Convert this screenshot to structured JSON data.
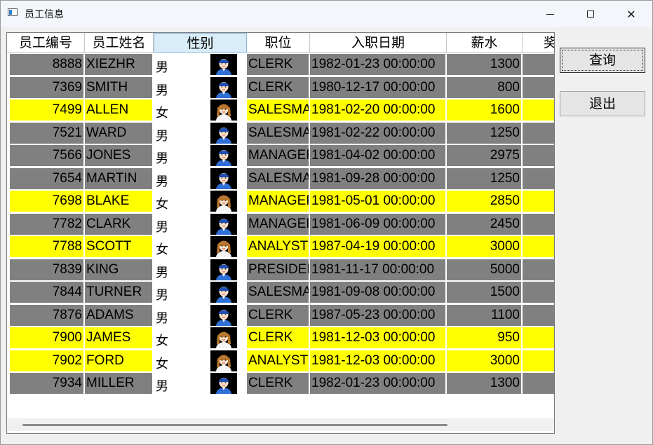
{
  "window": {
    "title": "员工信息"
  },
  "columns": [
    "员工编号",
    "员工姓名",
    "性别",
    "职位",
    "入职日期",
    "薪水",
    "奖"
  ],
  "colors": {
    "male_row": "#808080",
    "female_row": "#ffff00",
    "header_selected": "#d9edf9"
  },
  "rows": [
    {
      "empno": "8888",
      "ename": "XIEZHR",
      "sex": "男",
      "job": "CLERK",
      "hiredate": "1982-01-23 00:00:00",
      "sal": "1300",
      "avatar": "male-avatar-icon"
    },
    {
      "empno": "7369",
      "ename": "SMITH",
      "sex": "男",
      "job": "CLERK",
      "hiredate": "1980-12-17 00:00:00",
      "sal": "800",
      "avatar": "male-avatar-icon"
    },
    {
      "empno": "7499",
      "ename": "ALLEN",
      "sex": "女",
      "job": "SALESMA",
      "hiredate": "1981-02-20 00:00:00",
      "sal": "1600",
      "avatar": "female-avatar-icon"
    },
    {
      "empno": "7521",
      "ename": "WARD",
      "sex": "男",
      "job": "SALESMA",
      "hiredate": "1981-02-22 00:00:00",
      "sal": "1250",
      "avatar": "male-avatar-icon"
    },
    {
      "empno": "7566",
      "ename": "JONES",
      "sex": "男",
      "job": "MANAGER",
      "hiredate": "1981-04-02 00:00:00",
      "sal": "2975",
      "avatar": "male-avatar-icon"
    },
    {
      "empno": "7654",
      "ename": "MARTIN",
      "sex": "男",
      "job": "SALESMA",
      "hiredate": "1981-09-28 00:00:00",
      "sal": "1250",
      "avatar": "male-avatar-icon"
    },
    {
      "empno": "7698",
      "ename": "BLAKE",
      "sex": "女",
      "job": "MANAGER",
      "hiredate": "1981-05-01 00:00:00",
      "sal": "2850",
      "avatar": "female-avatar-icon"
    },
    {
      "empno": "7782",
      "ename": "CLARK",
      "sex": "男",
      "job": "MANAGER",
      "hiredate": "1981-06-09 00:00:00",
      "sal": "2450",
      "avatar": "male-avatar-icon"
    },
    {
      "empno": "7788",
      "ename": "SCOTT",
      "sex": "女",
      "job": "ANALYST",
      "hiredate": "1987-04-19 00:00:00",
      "sal": "3000",
      "avatar": "female-avatar-icon"
    },
    {
      "empno": "7839",
      "ename": "KING",
      "sex": "男",
      "job": "PRESIDENT",
      "hiredate": "1981-11-17 00:00:00",
      "sal": "5000",
      "avatar": "male-avatar-icon"
    },
    {
      "empno": "7844",
      "ename": "TURNER",
      "sex": "男",
      "job": "SALESMA",
      "hiredate": "1981-09-08 00:00:00",
      "sal": "1500",
      "avatar": "male-avatar-icon"
    },
    {
      "empno": "7876",
      "ename": "ADAMS",
      "sex": "男",
      "job": "CLERK",
      "hiredate": "1987-05-23 00:00:00",
      "sal": "1100",
      "avatar": "male-avatar-icon"
    },
    {
      "empno": "7900",
      "ename": "JAMES",
      "sex": "女",
      "job": "CLERK",
      "hiredate": "1981-12-03 00:00:00",
      "sal": "950",
      "avatar": "female-avatar-icon"
    },
    {
      "empno": "7902",
      "ename": "FORD",
      "sex": "女",
      "job": "ANALYST",
      "hiredate": "1981-12-03 00:00:00",
      "sal": "3000",
      "avatar": "female-avatar-icon"
    },
    {
      "empno": "7934",
      "ename": "MILLER",
      "sex": "男",
      "job": "CLERK",
      "hiredate": "1982-01-23 00:00:00",
      "sal": "1300",
      "avatar": "male-avatar-icon"
    }
  ],
  "buttons": {
    "query": "查询",
    "exit": "退出"
  }
}
